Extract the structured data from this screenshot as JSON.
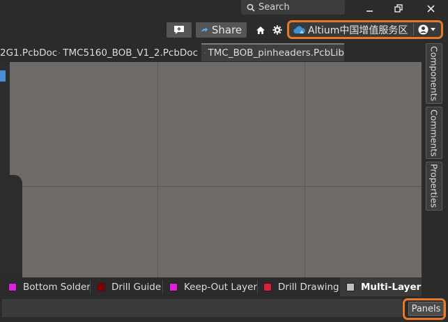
{
  "titlebar": {
    "search_placeholder": "Search",
    "minimize_label": "—",
    "restore_label": "🗗",
    "close_label": "✕"
  },
  "toolbar": {
    "share_label": "Share",
    "account_name": "Altium中国增值服务区"
  },
  "tabs": [
    {
      "label": "2G1.PcbDoc"
    },
    {
      "label": "TMC5160_BOB_V1_2.PcbDoc"
    },
    {
      "label": "TMC_BOB_pinheaders.PcbLib"
    }
  ],
  "side_panels": [
    {
      "label": "Components"
    },
    {
      "label": "Comments"
    },
    {
      "label": "Properties"
    }
  ],
  "layers": [
    {
      "label": "Bottom Solder",
      "color": "#e020e0"
    },
    {
      "label": "Drill Guide",
      "color": "#800000"
    },
    {
      "label": "Keep-Out Layer",
      "color": "#e020e0"
    },
    {
      "label": "Drill Drawing",
      "color": "#e0203a"
    },
    {
      "label": "Multi-Layer",
      "color": "#c0c0c0"
    }
  ],
  "status": {
    "panels_label": "Panels"
  },
  "colors": {
    "highlight": "#e8792b",
    "canvas": "#6e6a67"
  }
}
